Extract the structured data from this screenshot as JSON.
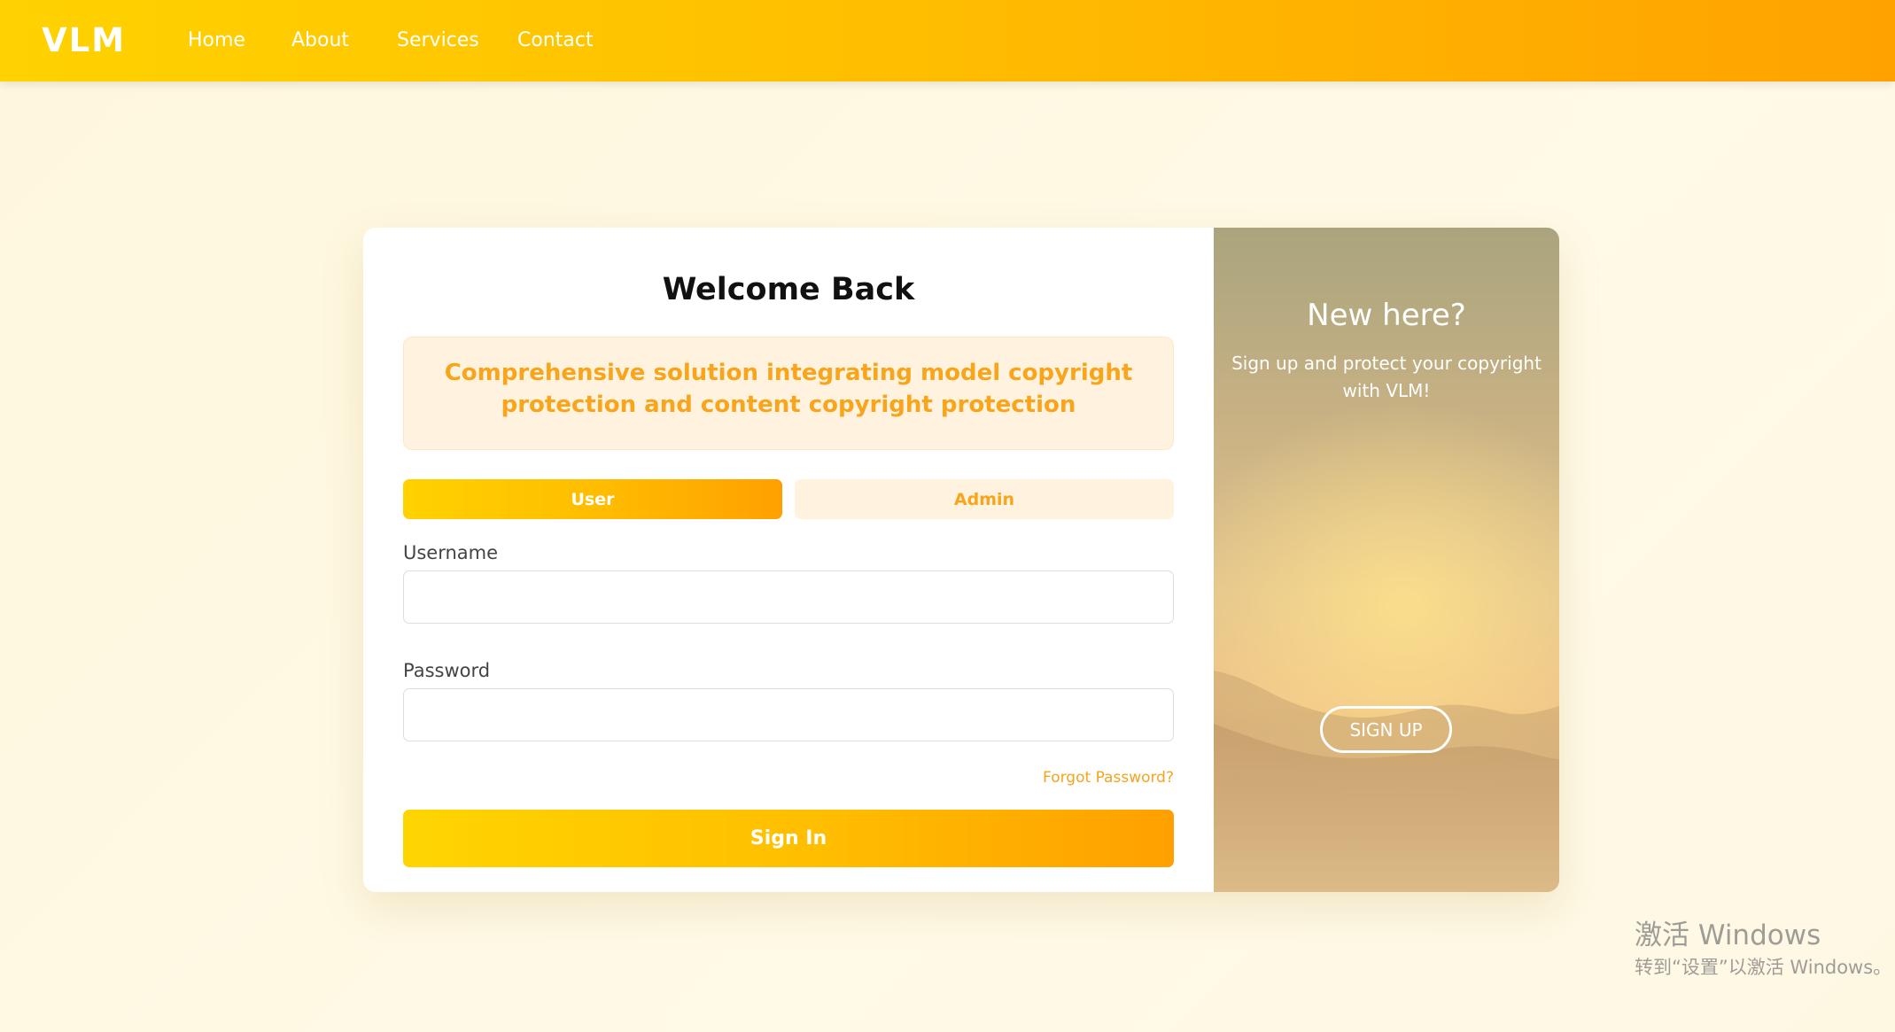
{
  "navbar": {
    "logo": "VLM",
    "links": [
      "Home",
      "About",
      "Services",
      "Contact"
    ]
  },
  "login": {
    "title": "Welcome Back",
    "tagline": "Comprehensive solution integrating model copyright protection and content copyright protection",
    "roles": {
      "user": "User",
      "admin": "Admin",
      "selected": "User"
    },
    "username_label": "Username",
    "username_value": "",
    "password_label": "Password",
    "password_value": "",
    "forgot_password": "Forgot Password?",
    "sign_in": "Sign In"
  },
  "signup_panel": {
    "title": "New here?",
    "text": "Sign up and protect your copyright with VLM!",
    "button": "SIGN UP"
  },
  "watermark": {
    "title": "激活 Windows",
    "text": "转到“设置”以激活 Windows。"
  },
  "colors": {
    "accent": "#ffb800",
    "accent_text": "#f9a51b",
    "page_background": "#fdf8e3",
    "tagline_background": "#fff3e0"
  }
}
